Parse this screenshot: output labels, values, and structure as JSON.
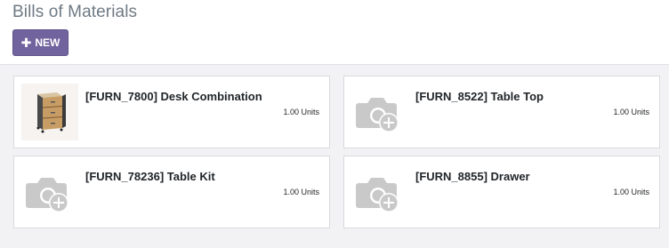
{
  "page": {
    "title": "Bills of Materials",
    "new_button_label": "NEW"
  },
  "cards": [
    {
      "name": "[FURN_7800] Desk Combination",
      "qty": "1.00 Units",
      "image": "desk-cabinet"
    },
    {
      "name": "[FURN_8522] Table Top",
      "qty": "1.00 Units",
      "image": "camera-placeholder"
    },
    {
      "name": "[FURN_78236] Table Kit",
      "qty": "1.00 Units",
      "image": "camera-placeholder"
    },
    {
      "name": "[FURN_8855] Drawer",
      "qty": "1.00 Units",
      "image": "camera-placeholder"
    }
  ],
  "colors": {
    "accent": "#71639e",
    "background": "#f2f2f5",
    "placeholder_icon": "#c9c9c9"
  }
}
